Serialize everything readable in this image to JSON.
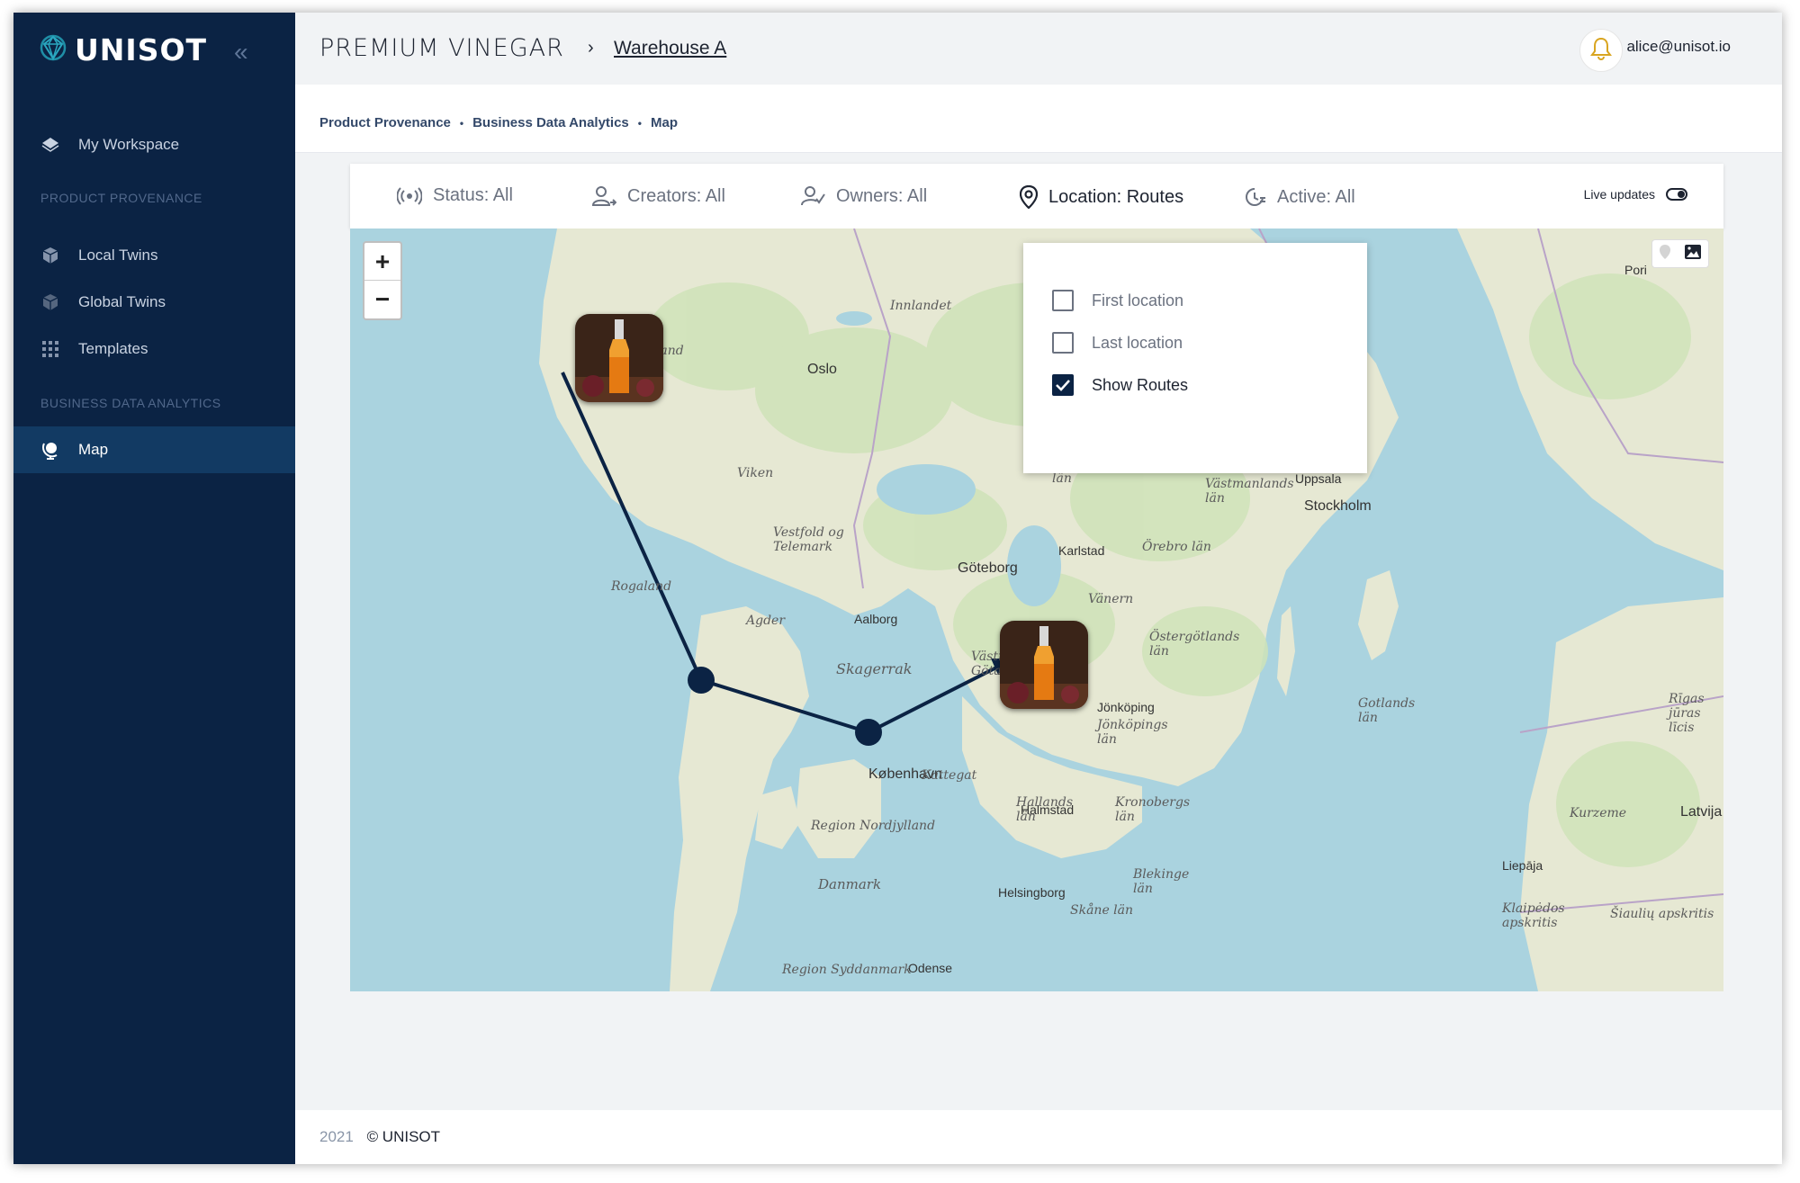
{
  "sidebar": {
    "logo_text": "UNISOT",
    "collapse_icon": "chevron-double-left-icon",
    "workspace": "My Workspace",
    "section1": "PRODUCT PROVENANCE",
    "local_twins": "Local Twins",
    "global_twins": "Global Twins",
    "templates": "Templates",
    "section2": "BUSINESS DATA ANALYTICS",
    "map": "Map"
  },
  "header": {
    "title": "PREMIUM VINEGAR",
    "separator": "›",
    "warehouse": "Warehouse A",
    "user": "alice@unisot.io"
  },
  "breadcrumb": [
    "Product Provenance",
    "Business Data Analytics",
    "Map"
  ],
  "filters": {
    "status": "Status: All",
    "creators": "Creators: All",
    "owners": "Owners: All",
    "location": "Location: Routes",
    "active": "Active: All",
    "live_updates": "Live updates"
  },
  "location_dropdown": {
    "first": "First location",
    "last": "Last location",
    "routes": "Show Routes"
  },
  "map": {
    "zoom_in": "+",
    "zoom_out": "−",
    "labels": {
      "oslo": "Oslo",
      "stockholm": "Stockholm",
      "goteborg": "Göteborg",
      "kobenhavn": "København",
      "uppsala": "Uppsala",
      "karlstad": "Karlstad",
      "jonkoping": "Jönköping",
      "halmstad": "Halmstad",
      "helsingborg": "Helsingborg",
      "aalborg": "Aalborg",
      "odense": "Odense",
      "liepaja": "Liepāja",
      "latvija": "Latvija",
      "pori": "Pori",
      "innlandet": "Innlandet",
      "vestland": "Vestland",
      "viken": "Viken",
      "rogaland": "Rogaland",
      "agder": "Agder",
      "vestfold": "Vestfold og Telemark",
      "skagerrak": "Skagerrak",
      "kattegat": "Kattegat",
      "vastra": "Västra Götalands län",
      "ostergotland": "Östergötlands län",
      "gotland": "Gotlands län",
      "kronoberg": "Kronobergs län",
      "blekinge": "Blekinge län",
      "skane": "Skåne län",
      "halland": "Hallands län",
      "danmark": "Danmark",
      "nordjylland": "Region Nordjylland",
      "syddanmark": "Region Syddanmark",
      "vastmanland": "Västmanlands län",
      "orebro": "Örebro län",
      "varmland": "Värmlands län",
      "vanern": "Vänern",
      "jonkopingslan": "Jönköpings län",
      "kurzeme": "Kurzeme",
      "rigas": "Rīgas jūras līcis",
      "klaipedos": "Klaipėdos apskritis",
      "siauliu": "Šiaulių apskritis"
    }
  },
  "footer": {
    "year": "2021",
    "copyright": "© UNISOT"
  },
  "colors": {
    "sidebar": "#0b2344",
    "active_item": "#123a63",
    "water": "#aad3df",
    "land": "#e9ead8",
    "route": "#0b2344"
  }
}
